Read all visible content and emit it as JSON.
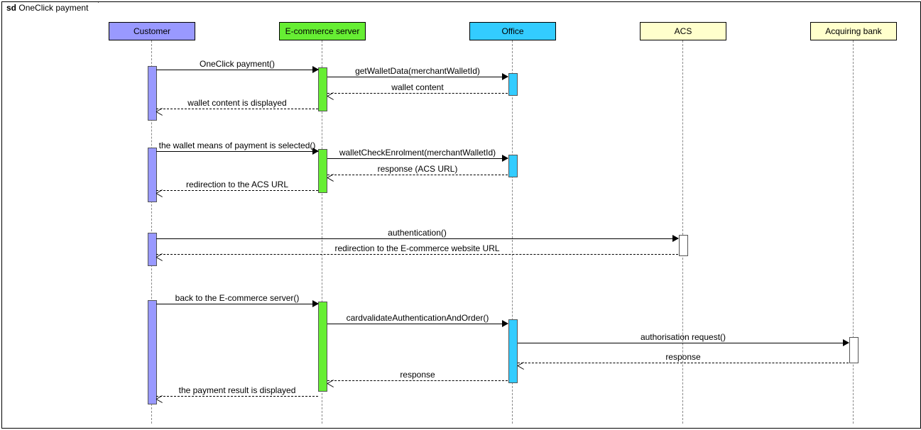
{
  "frame": {
    "sd": "sd",
    "title": "OneClick payment"
  },
  "lifelines": {
    "customer": "Customer",
    "ecommerce": "E-commerce server",
    "office": "Office",
    "acs": "ACS",
    "bank": "Acquiring bank"
  },
  "messages": {
    "m1": "OneClick payment()",
    "m2": "getWalletData(merchantWalletId)",
    "m3": "wallet content",
    "m4": "wallet content is displayed",
    "m5": "the wallet means of payment is selected()",
    "m6": "walletCheckEnrolment(merchantWalletId)",
    "m7": "response (ACS URL)",
    "m8": "redirection to the ACS URL",
    "m9": "authentication()",
    "m10": "redirection to the E-commerce website URL",
    "m11": "back to the E-commerce server()",
    "m12": "cardvalidateAuthenticationAndOrder()",
    "m13": "authorisation request()",
    "m14": "response",
    "m15": "response",
    "m16": "the payment result is displayed"
  },
  "colors": {
    "customer": "#9999ff",
    "ecommerce": "#66ee33",
    "office": "#33ccff",
    "acs": "#ffffcc",
    "bank": "#ffffcc"
  }
}
